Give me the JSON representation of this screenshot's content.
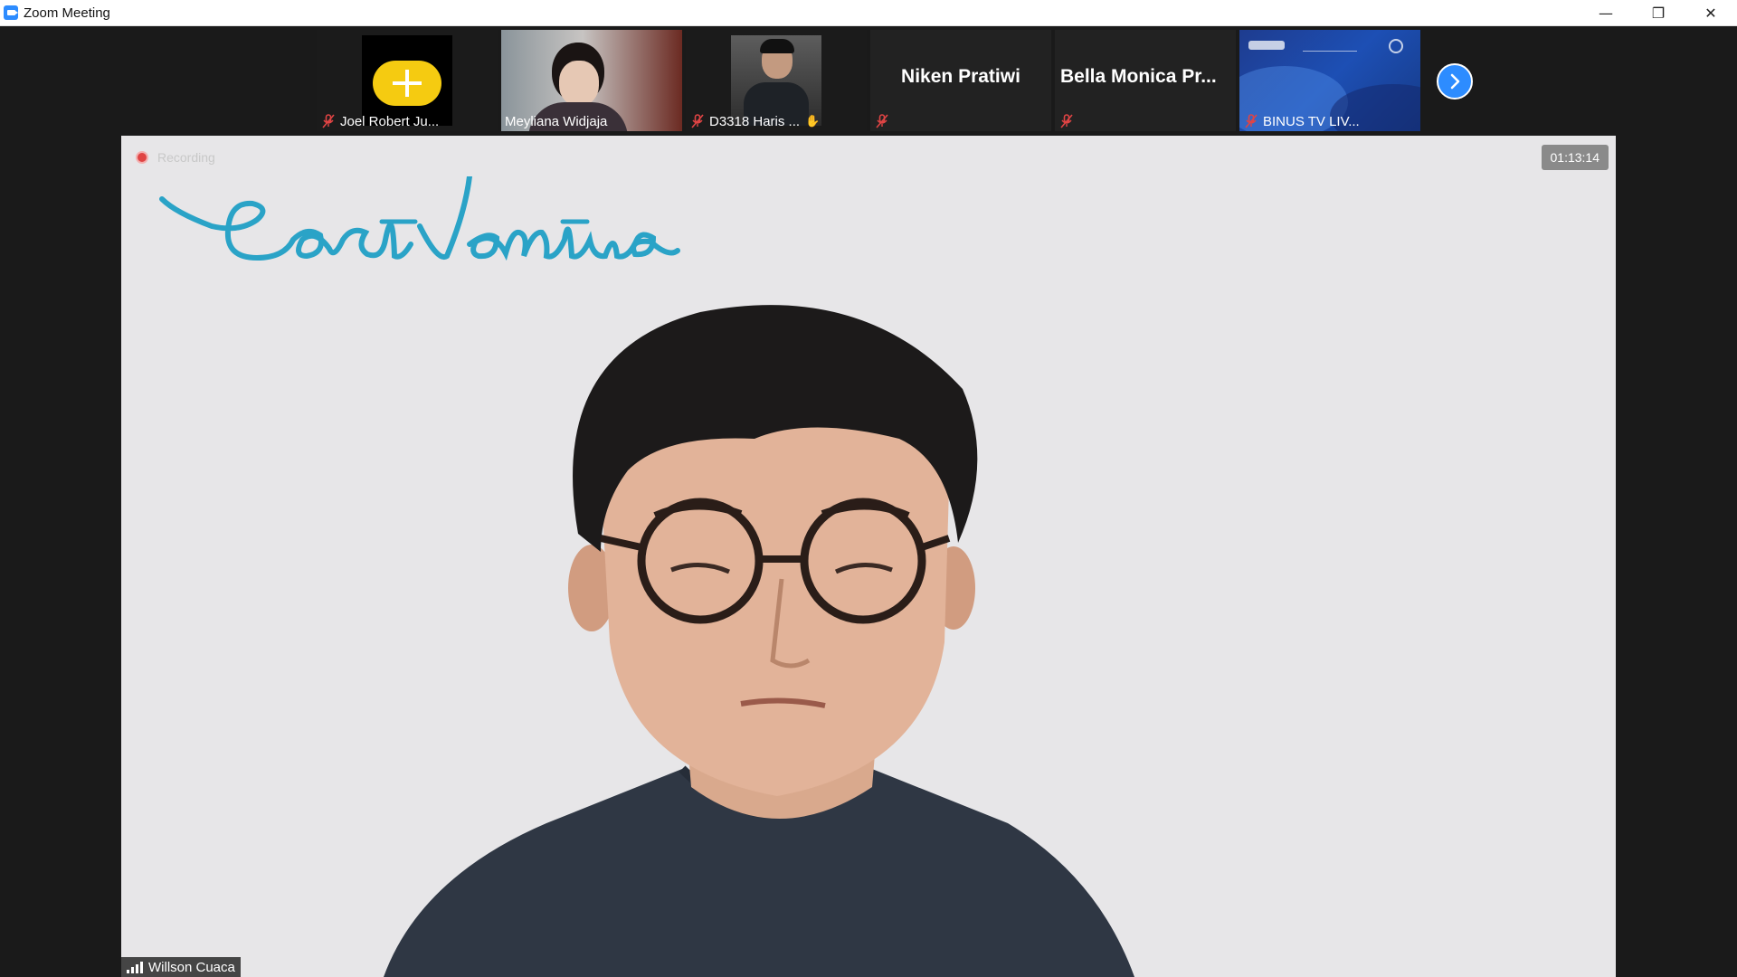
{
  "window": {
    "title": "Zoom Meeting",
    "controls": {
      "minimize": "—",
      "restore": "❐",
      "close": "✕"
    }
  },
  "participants": [
    {
      "name": "Joel Robert Ju...",
      "muted": true,
      "tile": "avatar"
    },
    {
      "name": "Meyliana Widjaja",
      "muted": false,
      "tile": "video"
    },
    {
      "name": "D3318 Haris ...",
      "muted": true,
      "tile": "video"
    },
    {
      "name": "",
      "display_name": "Niken Pratiwi",
      "muted": true,
      "tile": "name-only"
    },
    {
      "name": "",
      "display_name": "Bella  Monica  Pr...",
      "muted": true,
      "tile": "name-only"
    },
    {
      "name": "BINUS TV LIV...",
      "muted": true,
      "tile": "video"
    }
  ],
  "main": {
    "recording_label": "Recording",
    "timer": "01:13:14",
    "speaker_name": "Willson Cuaca",
    "logo_text": "East Ventures"
  },
  "colors": {
    "accent": "#2d8cff",
    "mute_red": "#e04444",
    "background": "#1a1a1a",
    "main_bg": "#e7e6e8",
    "logo_blue": "#2aa3c7"
  }
}
